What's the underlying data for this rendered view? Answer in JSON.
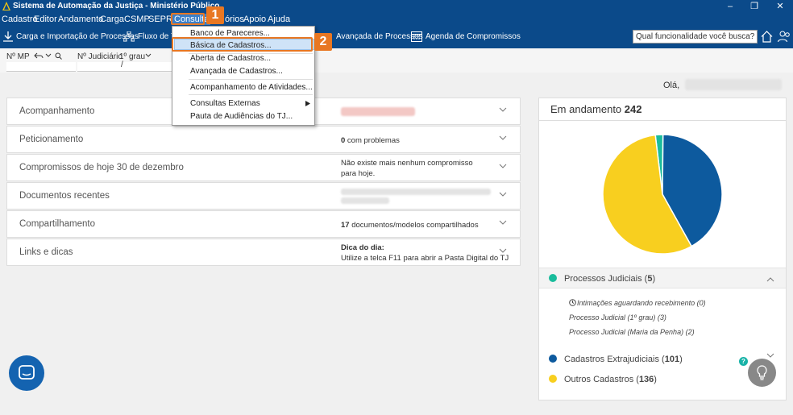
{
  "titlebar": {
    "title": "Sistema de Automação da Justiça - Ministério Público"
  },
  "menubar": {
    "items": [
      "Cadastro",
      "Editor",
      "Andamento",
      "Carga",
      "CSMP",
      "SEPRO",
      "Consulta",
      "órios",
      "Apoio",
      "Ajuda"
    ]
  },
  "toolbar": {
    "carga": "Carga e Importação de Processos",
    "fluxo": "Fluxo de Tr",
    "avancada": "Avançada de Processos",
    "agenda": "Agenda de Compromissos",
    "search_value": "Qual funcionalidade você busca?"
  },
  "quickbar": {
    "mp_label": "Nº MP",
    "judicial_label": "Nº Judiciário",
    "grau": "1º grau",
    "sep": "/"
  },
  "greeting": "Olá,",
  "panels": [
    {
      "title": "Acompanhamento"
    },
    {
      "title": "Peticionamento",
      "count": "0",
      "value": " com problemas"
    },
    {
      "title": "Compromissos de hoje 30 de dezembro",
      "value": "Não existe mais nenhum compromisso para hoje."
    },
    {
      "title": "Documentos recentes"
    },
    {
      "title": "Compartilhamento",
      "count": "17",
      "value": " documentos/modelos compartilhados"
    },
    {
      "title": "Links e dicas",
      "tip_title": "Dica do dia:",
      "value": "Utilize a telca F11 para abrir a Pasta Digital do TJ"
    }
  ],
  "right": {
    "header_label": "Em andamento",
    "header_count": "242",
    "legend": [
      {
        "label": "Processos Judiciais",
        "count": "5",
        "color": "#1abc9c"
      },
      {
        "label": "Cadastros Extrajudiciais",
        "count": "101",
        "color": "#0d5a9e"
      },
      {
        "label": "Outros Cadastros",
        "count": "136",
        "color": "#f8cf1f"
      }
    ],
    "sub_items": [
      "Intimações aguardando recebimento (0)",
      "Processo Judicial (1º grau) (3)",
      "Processo Judicial (Maria da Penha) (2)"
    ]
  },
  "dropdown": {
    "items": [
      "Banco de Pareceres...",
      "Básica de Cadastros...",
      "Aberta de Cadastros...",
      "Avançada de Cadastros...",
      "Acompanhamento de Atividades...",
      "Consultas Externas",
      "Pauta de Audiências do TJ..."
    ]
  },
  "callouts": [
    "1",
    "2"
  ],
  "help_glyph": "?",
  "chart_data": {
    "type": "pie",
    "categories": [
      "Processos Judiciais",
      "Cadastros Extrajudiciais",
      "Outros Cadastros"
    ],
    "values": [
      5,
      101,
      136
    ],
    "colors": [
      "#1abc9c",
      "#0d5a9e",
      "#f8cf1f"
    ]
  }
}
